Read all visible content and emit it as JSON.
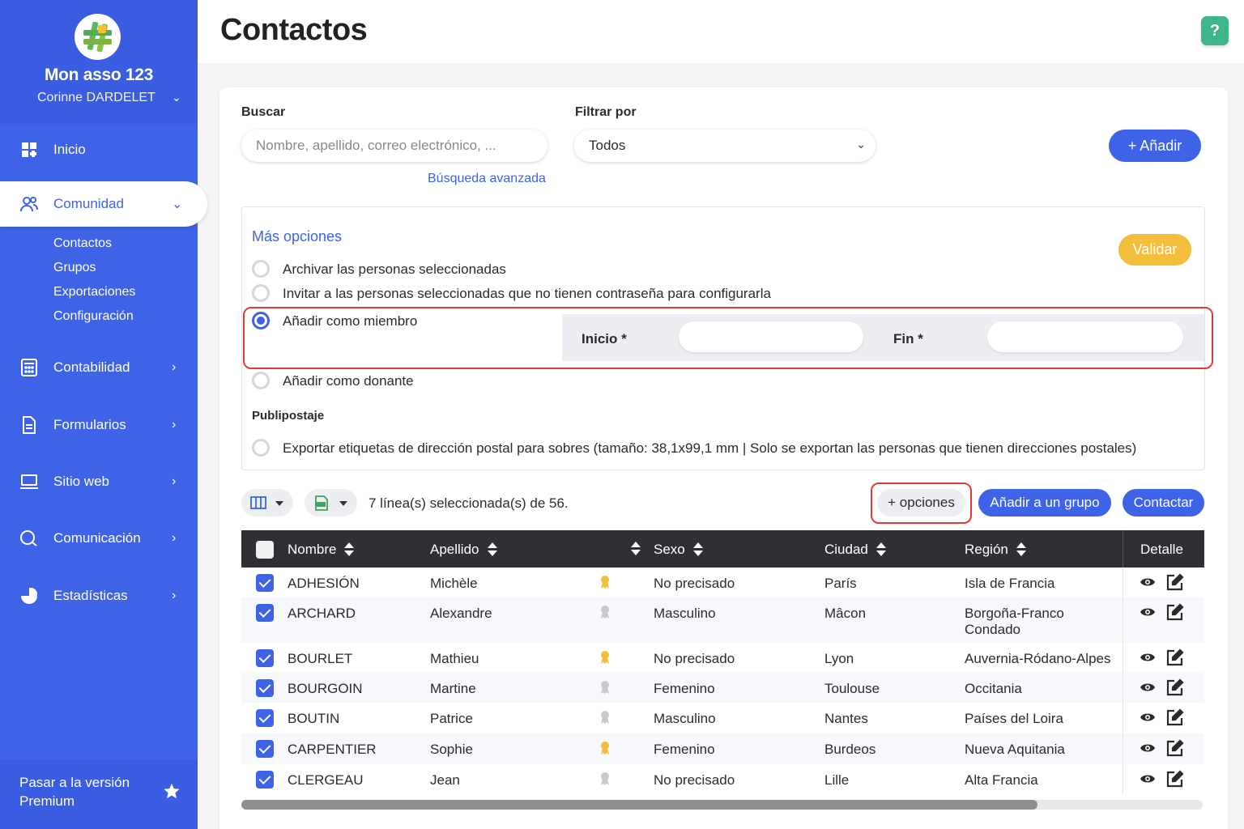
{
  "sidebar": {
    "org_name": "Mon asso 123",
    "user_name": "Corinne DARDELET",
    "nav": {
      "inicio": "Inicio",
      "comunidad": "Comunidad",
      "contabilidad": "Contabilidad",
      "formularios": "Formularios",
      "sitio_web": "Sitio web",
      "comunicacion": "Comunicación",
      "estadisticas": "Estadísticas"
    },
    "sub_items": [
      "Contactos",
      "Grupos",
      "Exportaciones",
      "Configuración"
    ],
    "premium": "Pasar a la versión Premium"
  },
  "header": {
    "title": "Contactos",
    "help_label": "?"
  },
  "search": {
    "label": "Buscar",
    "placeholder": "Nombre, apellido, correo electrónico, ...",
    "advanced_link": "Búsqueda avanzada"
  },
  "filter": {
    "label": "Filtrar por",
    "value": "Todos"
  },
  "add_button": "+ Añadir",
  "more_options": {
    "title": "Más opciones",
    "validate": "Validar",
    "options": [
      "Archivar las personas seleccionadas",
      "Invitar a las personas seleccionadas que no tienen contraseña para configurarla",
      "Añadir como miembro",
      "Añadir como donante"
    ],
    "selected_index": 2,
    "start_label": "Inicio *",
    "end_label": "Fin *",
    "mailing_title": "Publipostaje",
    "mailing_option": "Exportar etiquetas de dirección postal para sobres (tamaño: 38,1x99,1 mm | Solo se exportan las personas que tienen direcciones postales)"
  },
  "toolbar": {
    "selection_text": "7 línea(s) seleccionada(s) de 56.",
    "options_button": "+ opciones",
    "add_group_button": "Añadir a un grupo",
    "contact_button": "Contactar"
  },
  "table": {
    "columns": [
      "Nombre",
      "Apellido",
      "Sexo",
      "Ciudad",
      "Región",
      "Detalle"
    ],
    "rows": [
      {
        "nombre": "ADHESIÓN",
        "apellido": "Michèle",
        "badge": "gold",
        "sexo": "No precisado",
        "ciudad": "París",
        "region": "Isla de Francia"
      },
      {
        "nombre": "ARCHARD",
        "apellido": "Alexandre",
        "badge": "grey",
        "sexo": "Masculino",
        "ciudad": "Mâcon",
        "region": "Borgoña-Franco Condado"
      },
      {
        "nombre": "BOURLET",
        "apellido": "Mathieu",
        "badge": "gold",
        "sexo": "No precisado",
        "ciudad": "Lyon",
        "region": "Auvernia-Ródano-Alpes"
      },
      {
        "nombre": "BOURGOIN",
        "apellido": "Martine",
        "badge": "grey",
        "sexo": "Femenino",
        "ciudad": "Toulouse",
        "region": "Occitania"
      },
      {
        "nombre": "BOUTIN",
        "apellido": "Patrice",
        "badge": "grey",
        "sexo": "Masculino",
        "ciudad": "Nantes",
        "region": "Países del Loira"
      },
      {
        "nombre": "CARPENTIER",
        "apellido": "Sophie",
        "badge": "gold",
        "sexo": "Femenino",
        "ciudad": "Burdeos",
        "region": "Nueva Aquitania"
      },
      {
        "nombre": "CLERGEAU",
        "apellido": "Jean",
        "badge": "grey",
        "sexo": "No precisado",
        "ciudad": "Lille",
        "region": "Alta Francia"
      }
    ]
  },
  "colors": {
    "primary": "#3e63e6",
    "accent_yellow": "#f2be3b",
    "help_green": "#3fb58a",
    "highlight_red": "#e53935",
    "table_header": "#2f3033"
  }
}
